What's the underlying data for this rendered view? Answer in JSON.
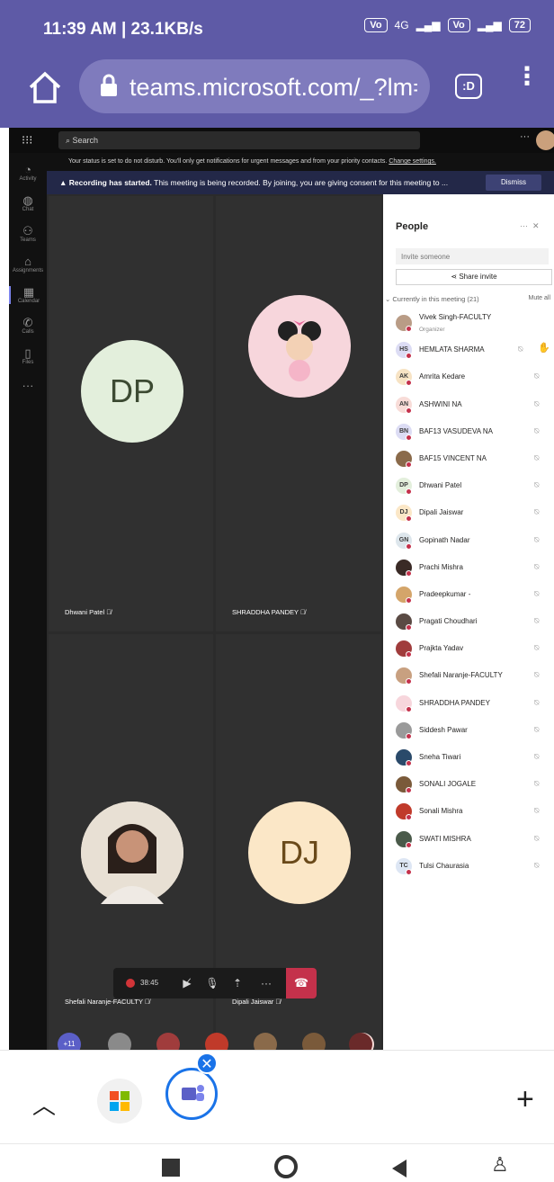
{
  "status_bar": {
    "time": "11:39 AM | 23.1KB/s",
    "network": "4G",
    "battery": "72"
  },
  "browser": {
    "url": "teams.microsoft.com/_?lm=",
    "tab_count": ":D"
  },
  "teams": {
    "search_placeholder": "Search",
    "rail": [
      "Activity",
      "Chat",
      "Teams",
      "Assignments",
      "Calendar",
      "Calls",
      "Files"
    ],
    "status_banner": {
      "text": "Your status is set to do not disturb. You'll only get notifications for urgent messages and from your priority contacts.",
      "link": "Change settings."
    },
    "recording_banner": {
      "title": "Recording has started.",
      "text": "This meeting is being recorded. By joining, you are giving consent for this meeting to ...",
      "dismiss": "Dismiss"
    },
    "tiles": [
      {
        "name": "Dhwani Patel",
        "initials": "DP"
      },
      {
        "name": "SHRADDHA PANDEY",
        "initials": ""
      },
      {
        "name": "Shefali Naranje-FACULTY",
        "initials": ""
      },
      {
        "name": "Dipali Jaiswar",
        "initials": "DJ"
      }
    ],
    "call_timer": "38:45",
    "strip": {
      "overflow": "+11",
      "last_initials": "AN"
    },
    "people": {
      "title": "People",
      "invite_placeholder": "Invite someone",
      "share_invite": "Share invite",
      "section": "Currently in this meeting (21)",
      "mute_all": "Mute all",
      "participants": [
        {
          "name": "Vivek Singh-FACULTY",
          "sub": "Organizer",
          "initials": "",
          "color": "#b99c86"
        },
        {
          "name": "HEMLATA SHARMA",
          "initials": "HS",
          "color": "#dcdcf4",
          "hand": true
        },
        {
          "name": "Amrita Kedare",
          "initials": "AK",
          "color": "#f7e3c4"
        },
        {
          "name": "ASHWINI NA",
          "initials": "AN",
          "color": "#f8dcd8"
        },
        {
          "name": "BAF13 VASUDEVA NA",
          "initials": "BN",
          "color": "#dcdcf4"
        },
        {
          "name": "BAF15 VINCENT NA",
          "initials": "",
          "color": "#8a6a4a"
        },
        {
          "name": "Dhwani Patel",
          "initials": "DP",
          "color": "#e3efdc"
        },
        {
          "name": "Dipali Jaiswar",
          "initials": "DJ",
          "color": "#fbe7c7"
        },
        {
          "name": "Gopinath Nadar",
          "initials": "GN",
          "color": "#dde6ec"
        },
        {
          "name": "Prachi Mishra",
          "initials": "",
          "color": "#3a2a26"
        },
        {
          "name": "Pradeepkumar -",
          "initials": "",
          "color": "#d4a56a"
        },
        {
          "name": "Pragati Choudhari",
          "initials": "",
          "color": "#5a4a44"
        },
        {
          "name": "Prajkta Yadav",
          "initials": "",
          "color": "#a03c3c"
        },
        {
          "name": "Shefali Naranje-FACULTY",
          "initials": "",
          "color": "#c8a080"
        },
        {
          "name": "SHRADDHA PANDEY",
          "initials": "",
          "color": "#f7d6dc"
        },
        {
          "name": "Siddesh Pawar",
          "initials": "",
          "color": "#9a9a9a"
        },
        {
          "name": "Sneha Tiwari",
          "initials": "",
          "color": "#2a4a6a"
        },
        {
          "name": "SONALI JOGALE",
          "initials": "",
          "color": "#7a5a3a"
        },
        {
          "name": "Sonali Mishra",
          "initials": "",
          "color": "#c03a2a"
        },
        {
          "name": "SWATI MISHRA",
          "initials": "",
          "color": "#4a5a4a"
        },
        {
          "name": "Tulsi Chaurasia",
          "initials": "TC",
          "color": "#dde6f4"
        }
      ]
    }
  }
}
